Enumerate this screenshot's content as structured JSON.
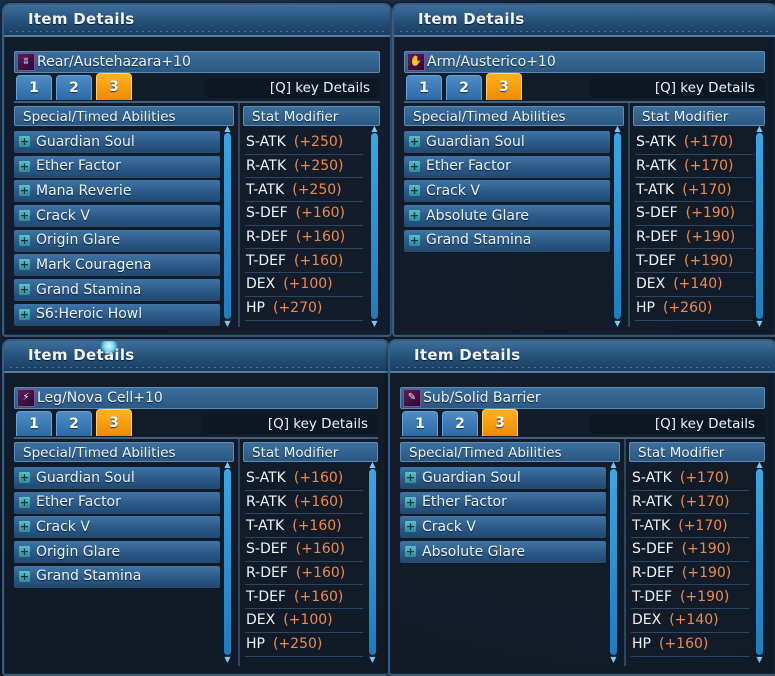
{
  "panels": [
    {
      "title": "Item Details",
      "item": {
        "icon": "rear-unit-icon",
        "glyph": "ʬ",
        "name": "Rear/Austehazara+10"
      },
      "tabs": [
        "1",
        "2",
        "3"
      ],
      "active_tab": "3",
      "qkey_label": "[Q] key  Details",
      "abilities_header": "Special/Timed Abilities",
      "stats_header": "Stat Modifier",
      "abilities": [
        "Guardian Soul",
        "Ether Factor",
        "Mana Reverie",
        "Crack V",
        "Origin Glare",
        "Mark Couragena",
        "Grand Stamina",
        "S6:Heroic Howl"
      ],
      "stats": [
        {
          "name": "S-ATK",
          "value": "(+250)"
        },
        {
          "name": "R-ATK",
          "value": "(+250)"
        },
        {
          "name": "T-ATK",
          "value": "(+250)"
        },
        {
          "name": "S-DEF",
          "value": "(+160)"
        },
        {
          "name": "R-DEF",
          "value": "(+160)"
        },
        {
          "name": "T-DEF",
          "value": "(+160)"
        },
        {
          "name": "DEX",
          "value": "(+100)"
        },
        {
          "name": "HP",
          "value": "(+270)"
        }
      ]
    },
    {
      "title": "Item Details",
      "item": {
        "icon": "arm-unit-icon",
        "glyph": "✋",
        "name": "Arm/Austerico+10"
      },
      "tabs": [
        "1",
        "2",
        "3"
      ],
      "active_tab": "3",
      "qkey_label": "[Q] key  Details",
      "abilities_header": "Special/Timed Abilities",
      "stats_header": "Stat Modifier",
      "abilities": [
        "Guardian Soul",
        "Ether Factor",
        "Crack V",
        "Absolute Glare",
        "Grand Stamina"
      ],
      "stats": [
        {
          "name": "S-ATK",
          "value": "(+170)"
        },
        {
          "name": "R-ATK",
          "value": "(+170)"
        },
        {
          "name": "T-ATK",
          "value": "(+170)"
        },
        {
          "name": "S-DEF",
          "value": "(+190)"
        },
        {
          "name": "R-DEF",
          "value": "(+190)"
        },
        {
          "name": "T-DEF",
          "value": "(+190)"
        },
        {
          "name": "DEX",
          "value": "(+140)"
        },
        {
          "name": "HP",
          "value": "(+260)"
        }
      ]
    },
    {
      "title": "Item Details",
      "item": {
        "icon": "leg-unit-icon",
        "glyph": "⚡",
        "name": "Leg/Nova Cell+10"
      },
      "tabs": [
        "1",
        "2",
        "3"
      ],
      "active_tab": "3",
      "qkey_label": "[Q] key  Details",
      "abilities_header": "Special/Timed Abilities",
      "stats_header": "Stat Modifier",
      "abilities": [
        "Guardian Soul",
        "Ether Factor",
        "Crack V",
        "Origin Glare",
        "Grand Stamina"
      ],
      "stats": [
        {
          "name": "S-ATK",
          "value": "(+160)"
        },
        {
          "name": "R-ATK",
          "value": "(+160)"
        },
        {
          "name": "T-ATK",
          "value": "(+160)"
        },
        {
          "name": "S-DEF",
          "value": "(+160)"
        },
        {
          "name": "R-DEF",
          "value": "(+160)"
        },
        {
          "name": "T-DEF",
          "value": "(+160)"
        },
        {
          "name": "DEX",
          "value": "(+100)"
        },
        {
          "name": "HP",
          "value": "(+250)"
        }
      ]
    },
    {
      "title": "Item Details",
      "item": {
        "icon": "sub-unit-icon",
        "glyph": "✎",
        "name": "Sub/Solid Barrier"
      },
      "tabs": [
        "1",
        "2",
        "3"
      ],
      "active_tab": "3",
      "qkey_label": "[Q] key  Details",
      "abilities_header": "Special/Timed Abilities",
      "stats_header": "Stat Modifier",
      "abilities": [
        "Guardian Soul",
        "Ether Factor",
        "Crack V",
        "Absolute Glare"
      ],
      "stats": [
        {
          "name": "S-ATK",
          "value": "(+170)"
        },
        {
          "name": "R-ATK",
          "value": "(+170)"
        },
        {
          "name": "T-ATK",
          "value": "(+170)"
        },
        {
          "name": "S-DEF",
          "value": "(+190)"
        },
        {
          "name": "R-DEF",
          "value": "(+190)"
        },
        {
          "name": "T-DEF",
          "value": "(+190)"
        },
        {
          "name": "DEX",
          "value": "(+140)"
        },
        {
          "name": "HP",
          "value": "(+160)"
        }
      ]
    }
  ],
  "colors": {
    "active_tab": "#f08a00",
    "inactive_tab": "#2d6aa6",
    "stat_value": "#f08a4a",
    "header_bar": "#2b5883"
  }
}
